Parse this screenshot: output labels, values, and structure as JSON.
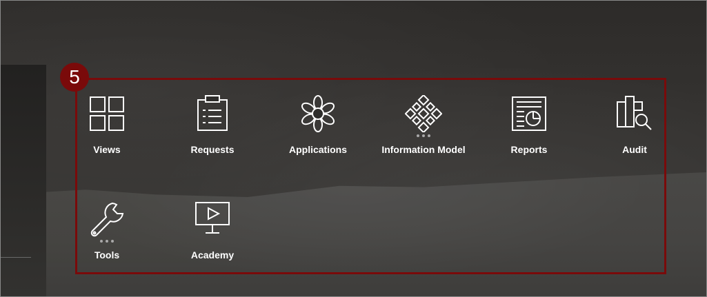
{
  "step": {
    "number": "5"
  },
  "colors": {
    "highlight": "#7a0a0a",
    "label": "#ffffff",
    "more_dots": "#a9a9a9"
  },
  "tiles": [
    {
      "label": "Views",
      "icon": "views-grid-icon",
      "has_more": false
    },
    {
      "label": "Requests",
      "icon": "clipboard-list-icon",
      "has_more": false
    },
    {
      "label": "Applications",
      "icon": "flower-icon",
      "has_more": false
    },
    {
      "label": "Information Model",
      "icon": "diamond-network-icon",
      "has_more": true
    },
    {
      "label": "Reports",
      "icon": "report-chart-icon",
      "has_more": false
    },
    {
      "label": "Audit",
      "icon": "audit-search-icon",
      "has_more": false
    },
    {
      "label": "Tools",
      "icon": "wrench-icon",
      "has_more": true
    },
    {
      "label": "Academy",
      "icon": "presentation-play-icon",
      "has_more": false
    }
  ]
}
